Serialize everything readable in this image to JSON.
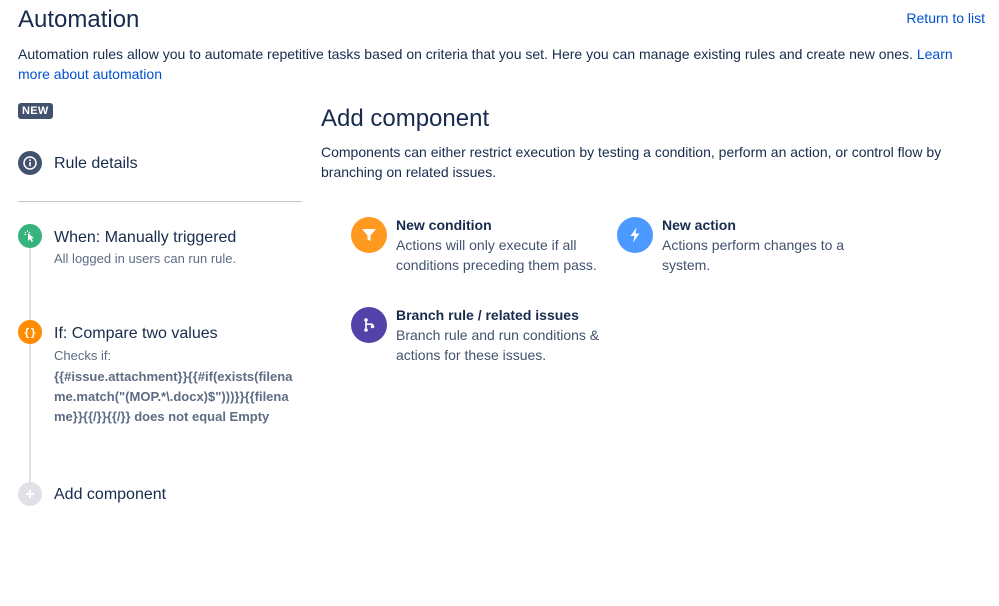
{
  "header": {
    "title": "Automation",
    "return_link": "Return to list",
    "intro_text": "Automation rules allow you to automate repetitive tasks based on criteria that you set. Here you can manage existing rules and create new ones. ",
    "learn_more": "Learn more about automation"
  },
  "sidebar": {
    "badge": "NEW",
    "rule_details": "Rule details",
    "trigger": {
      "title": "When: Manually triggered",
      "subtitle": "All logged in users can run rule."
    },
    "condition": {
      "title": "If: Compare two values",
      "checks_label": "Checks if:",
      "expression": "{{#issue.attachment}}{{#if(exists(filename.match(\"(MOP.*\\.docx)$\")))}}{{filename}}{{/}}{{/}} does not equal Empty"
    },
    "add_component": "Add component"
  },
  "main": {
    "title": "Add component",
    "description": "Components can either restrict execution by testing a condition, perform an action, or control flow by branching on related issues.",
    "components": {
      "condition": {
        "title": "New condition",
        "description": "Actions will only execute if all conditions preceding them pass.",
        "icon": "filter-icon",
        "color": "#ff991f"
      },
      "action": {
        "title": "New action",
        "description": "Actions perform changes to a system.",
        "icon": "lightning-icon",
        "color": "#4c9aff"
      },
      "branch": {
        "title": "Branch rule / related issues",
        "description": "Branch rule and run conditions & actions for these issues.",
        "icon": "branch-icon",
        "color": "#5243aa"
      }
    }
  }
}
